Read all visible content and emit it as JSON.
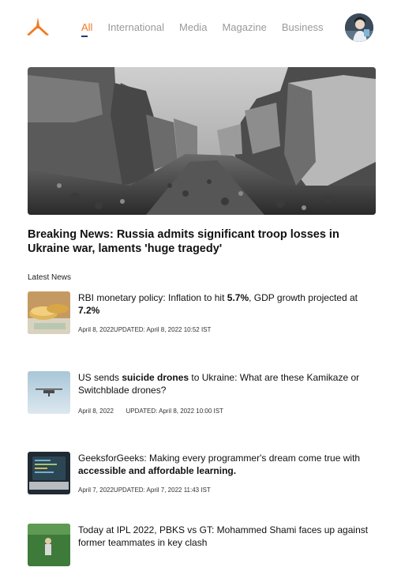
{
  "nav": {
    "tabs": [
      "All",
      "International",
      "Media",
      "Magazine",
      "Business"
    ],
    "active_index": 0
  },
  "icons": {
    "logo": "tripod-logo-icon",
    "avatar": "user-avatar"
  },
  "colors": {
    "accent": "#f07a22",
    "tab_inactive": "#9a9a9a",
    "underline": "#1d3b7a"
  },
  "hero": {
    "title": "Breaking News: Russia admits significant troop losses in Ukraine war, laments  'huge tragedy'"
  },
  "latest": {
    "label": "Latest News",
    "items": [
      {
        "headline_parts": [
          {
            "text": "RBI monetary policy: Inflation to hit ",
            "bold": false
          },
          {
            "text": "5.7%",
            "bold": true
          },
          {
            "text": ", GDP growth projected at ",
            "bold": false
          },
          {
            "text": "7.2%",
            "bold": true
          }
        ],
        "meta": "April 8, 2022UPDATED: April 8, 2022 10:52 IST"
      },
      {
        "headline_parts": [
          {
            "text": "US sends ",
            "bold": false
          },
          {
            "text": "suicide drones",
            "bold": true
          },
          {
            "text": " to Ukraine: What are these Kamikaze or Switchblade drones?",
            "bold": false
          }
        ],
        "meta": "April 8, 2022       UPDATED: April 8, 2022 10:00 IST"
      },
      {
        "headline_parts": [
          {
            "text": "GeeksforGeeks: Making every programmer's dream come true with ",
            "bold": false
          },
          {
            "text": "accessible and affordable learning.",
            "bold": true
          }
        ],
        "meta": "April 7, 2022UPDATED: April 7, 2022 11:43 IST"
      },
      {
        "headline_parts": [
          {
            "text": "Today at IPL 2022, PBKS vs GT: Mohammed Shami faces up against former teammates in key clash",
            "bold": false
          }
        ],
        "meta": ""
      }
    ]
  }
}
